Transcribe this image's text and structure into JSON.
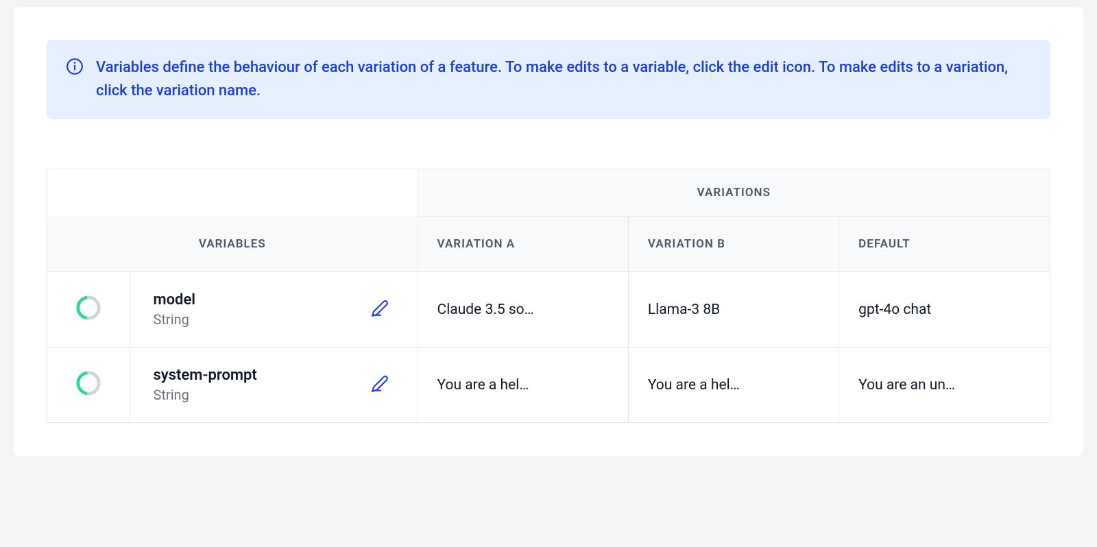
{
  "info_banner": {
    "text": "Variables define the behaviour of each variation of a feature. To make edits to a variable, click the edit icon. To make edits to a variation, click the variation name."
  },
  "table": {
    "headers": {
      "variables": "VARIABLES",
      "variations_group": "VARIATIONS",
      "columns": [
        "VARIATION A",
        "VARIATION B",
        "DEFAULT"
      ]
    },
    "rows": [
      {
        "name": "model",
        "type": "String",
        "values": [
          "Claude 3.5 so…",
          "Llama-3 8B",
          "gpt-4o chat"
        ]
      },
      {
        "name": "system-prompt",
        "type": "String",
        "values": [
          "You are a hel…",
          "You are a hel…",
          "You are an un…"
        ]
      }
    ]
  }
}
